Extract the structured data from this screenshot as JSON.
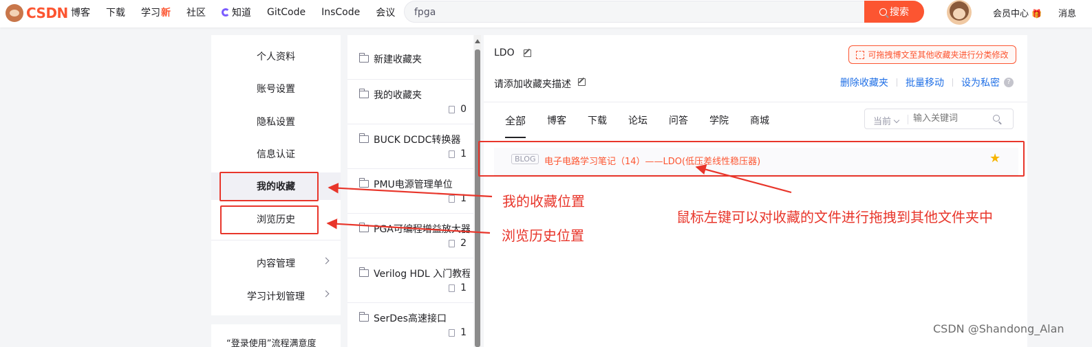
{
  "header": {
    "logo": "CSDN",
    "nav": [
      {
        "label": "博客"
      },
      {
        "label": "下载"
      },
      {
        "label": "学习",
        "badge": "新"
      },
      {
        "label": "社区"
      },
      {
        "label": "知道"
      },
      {
        "label": "GitCode"
      },
      {
        "label": "InsCode"
      },
      {
        "label": "会议"
      }
    ],
    "search": {
      "value": "fpga",
      "button": "搜索"
    },
    "vip_label": "会员中心",
    "msg_label": "消息"
  },
  "sidebar": {
    "items": [
      {
        "label": "个人资料"
      },
      {
        "label": "账号设置"
      },
      {
        "label": "隐私设置"
      },
      {
        "label": "信息认证"
      },
      {
        "label": "我的收藏"
      },
      {
        "label": "浏览历史"
      },
      {
        "label": "内容管理"
      },
      {
        "label": "学习计划管理"
      }
    ],
    "bottom_card": "“登录使用”流程满意度"
  },
  "folders": [
    {
      "name": "新建收藏夹",
      "count": ""
    },
    {
      "name": "我的收藏夹",
      "count": "0"
    },
    {
      "name": "BUCK DCDC转换器",
      "count": "1"
    },
    {
      "name": "PMU电源管理单位",
      "count": "1"
    },
    {
      "name": "PGA可编程增益放大器",
      "count": "2"
    },
    {
      "name": "Verilog HDL 入门教程",
      "count": "1"
    },
    {
      "name": "SerDes高速接口",
      "count": "1"
    }
  ],
  "main": {
    "folder_title": "LDO",
    "drag_tip": "可拖拽博文至其他收藏夹进行分类修改",
    "desc_placeholder": "请添加收藏夹描述",
    "actions": [
      "删除收藏夹",
      "批量移动",
      "设为私密"
    ],
    "tabs": [
      "全部",
      "博客",
      "下载",
      "论坛",
      "问答",
      "学院",
      "商城"
    ],
    "filter": {
      "scope": "当前",
      "placeholder": "输入关键词"
    },
    "items": [
      {
        "tag": "BLOG",
        "title": "电子电路学习笔记（14）——LDO(低压差线性稳压器)"
      }
    ]
  },
  "annotations": {
    "favorites": "我的收藏位置",
    "history": "浏览历史位置",
    "drag": "鼠标左键可以对收藏的文件进行拖拽到其他文件夹中"
  },
  "watermark": "CSDN @Shandong_Alan",
  "colors": {
    "brand": "#fc5531",
    "link": "#1f6fe6",
    "annotation": "#e8352a",
    "star": "#f7b500"
  }
}
